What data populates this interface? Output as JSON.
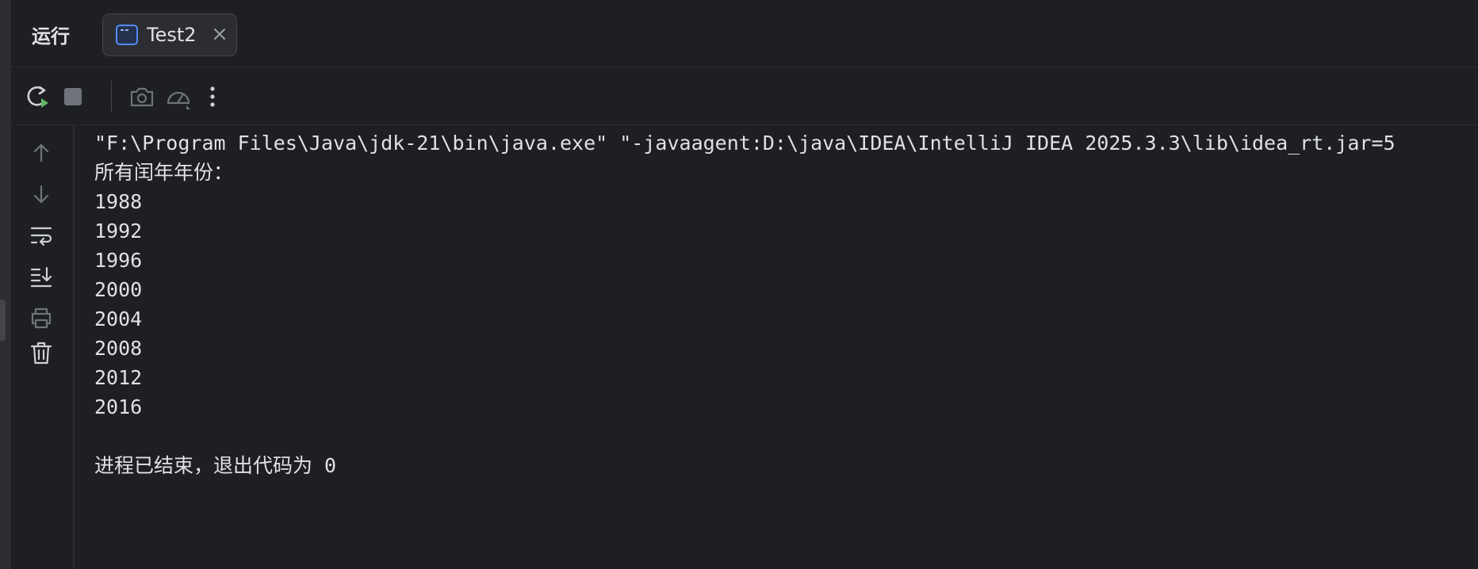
{
  "run_panel": {
    "title": "运行",
    "tab": {
      "label": "Test2",
      "icon": "console-window-icon",
      "close_icon": "close-icon"
    }
  },
  "toolbar": {
    "buttons": [
      {
        "name": "rerun-button",
        "icon": "rerun-icon"
      },
      {
        "name": "stop-button",
        "icon": "stop-icon"
      },
      {
        "name": "screenshot-button",
        "icon": "camera-icon"
      },
      {
        "name": "profiler-button",
        "icon": "speedometer-icon"
      },
      {
        "name": "more-options-button",
        "icon": "more-vertical-icon"
      }
    ]
  },
  "side_toolbar": {
    "buttons": [
      {
        "name": "scroll-up-button",
        "icon": "arrow-up-icon"
      },
      {
        "name": "scroll-down-button",
        "icon": "arrow-down-icon"
      },
      {
        "name": "soft-wrap-button",
        "icon": "soft-wrap-icon"
      },
      {
        "name": "scroll-to-end-button",
        "icon": "scroll-to-end-icon"
      },
      {
        "name": "print-button",
        "icon": "printer-icon"
      },
      {
        "name": "clear-all-button",
        "icon": "trash-icon"
      }
    ]
  },
  "console": {
    "lines": [
      "\"F:\\Program Files\\Java\\jdk-21\\bin\\java.exe\" \"-javaagent:D:\\java\\IDEA\\IntelliJ IDEA 2025.3.3\\lib\\idea_rt.jar=5",
      "所有闰年年份：",
      "1988",
      "1992",
      "1996",
      "2000",
      "2004",
      "2008",
      "2012",
      "2016",
      "",
      "进程已结束，退出代码为 0"
    ]
  },
  "colors": {
    "background": "#1e1f22",
    "panel_header": "#2b2d30",
    "text": "#dfe1e5",
    "icon": "#ced0d6",
    "icon_disabled": "#6f737a",
    "accent_blue": "#548af7",
    "run_green": "#5fb865"
  }
}
